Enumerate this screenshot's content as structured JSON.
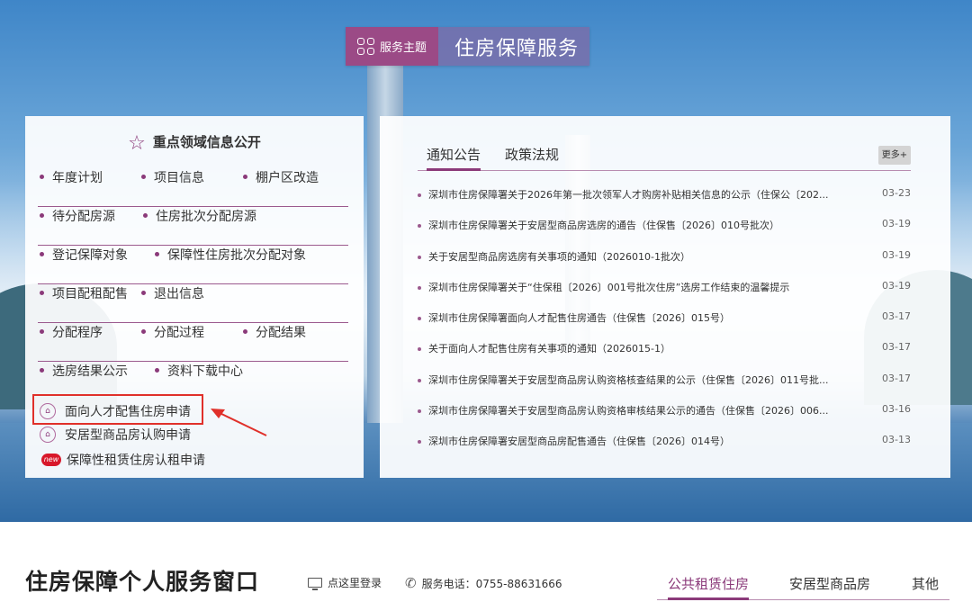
{
  "theme": {
    "label": "服务主题",
    "title": "住房保障服务"
  },
  "left_panel": {
    "title": "重点领域信息公开",
    "rows": [
      [
        "年度计划",
        "项目信息",
        "棚户区改造"
      ],
      [
        "待分配房源",
        "住房批次分配房源"
      ],
      [
        "登记保障对象",
        "保障性住房批次分配对象"
      ],
      [
        "项目配租配售",
        "退出信息"
      ],
      [
        "分配程序",
        "分配过程",
        "分配结果"
      ],
      [
        "选房结果公示",
        "资料下载中心"
      ]
    ],
    "applications": [
      {
        "label": "面向人才配售住房申请",
        "icon": "house-badge-icon"
      },
      {
        "label": "安居型商品房认购申请",
        "icon": "house-badge-icon"
      },
      {
        "label": "保障性租赁住房认租申请",
        "icon": "new-badge-icon",
        "badge": "new"
      }
    ]
  },
  "right_panel": {
    "tabs": [
      "通知公告",
      "政策法规"
    ],
    "active_tab": "通知公告",
    "more_label": "更多+",
    "news": [
      {
        "title": "深圳市住房保障署关于2026年第一批次领军人才购房补贴相关信息的公示（住保公〔202...",
        "date": "03-23"
      },
      {
        "title": "深圳市住房保障署关于安居型商品房选房的通告（住保售〔2026〕010号批次）",
        "date": "03-19"
      },
      {
        "title": "关于安居型商品房选房有关事项的通知（2026010-1批次）",
        "date": "03-19"
      },
      {
        "title": "深圳市住房保障署关于“住保租〔2026〕001号批次住房”选房工作结束的温馨提示",
        "date": "03-19"
      },
      {
        "title": "深圳市住房保障署面向人才配售住房通告（住保售〔2026〕015号）",
        "date": "03-17"
      },
      {
        "title": "关于面向人才配售住房有关事项的通知（2026015-1）",
        "date": "03-17"
      },
      {
        "title": "深圳市住房保障署关于安居型商品房认购资格核查结果的公示（住保售〔2026〕011号批...",
        "date": "03-17"
      },
      {
        "title": "深圳市住房保障署关于安居型商品房认购资格审核结果公示的通告（住保售〔2026〕006...",
        "date": "03-16"
      },
      {
        "title": "深圳市住房保障署安居型商品房配售通告（住保售〔2026〕014号）",
        "date": "03-13"
      }
    ]
  },
  "bottom": {
    "title": "住房保障个人服务窗口",
    "login": "点这里登录",
    "phone": "服务电话：0755-88631666",
    "tabs": [
      "公共租赁住房",
      "安居型商品房",
      "其他"
    ],
    "active_tab": "公共租赁住房"
  },
  "colors": {
    "accent": "#8b3a7a",
    "annotation": "#e0302a"
  }
}
